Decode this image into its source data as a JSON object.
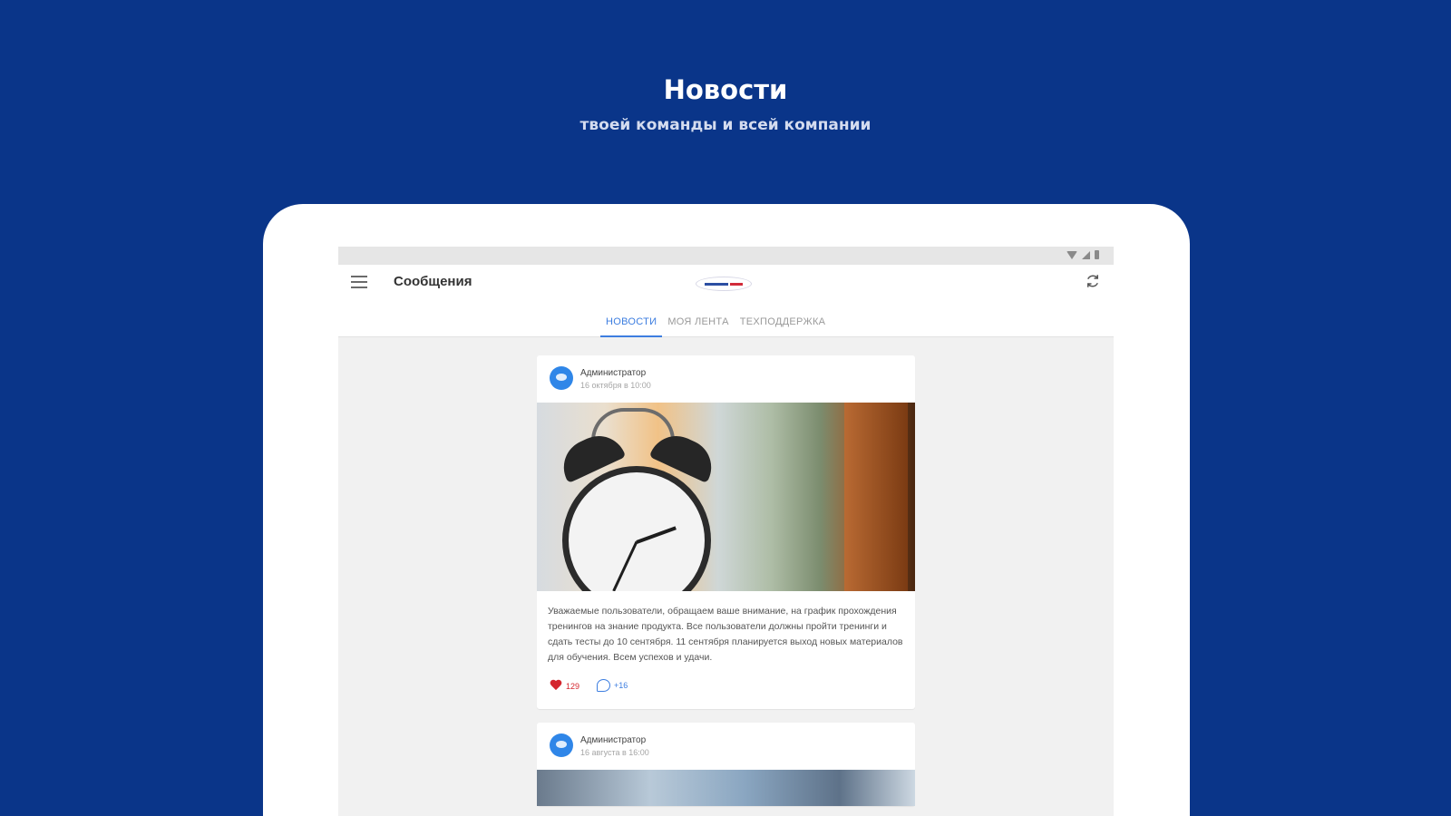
{
  "hero": {
    "title": "Новости",
    "subtitle": "твоей команды и всей компании"
  },
  "app": {
    "title": "Сообщения",
    "tabs": [
      {
        "label": "НОВОСТИ",
        "active": true
      },
      {
        "label": "МОЯ ЛЕНТА",
        "active": false
      },
      {
        "label": "ТЕХПОДДЕРЖКА",
        "active": false
      }
    ]
  },
  "posts": [
    {
      "author": "Администратор",
      "date": "16 октября в 10:00",
      "text": "Уважаемые пользователи, обращаем ваше внимание, на график прохождения тренингов на знание продукта. Все пользователи должны пройти тренинги и сдать тесты до 10 сентября. 11 сентября планируется выход новых материалов для обучения. Всем успехов и удачи.",
      "likes": "129",
      "comments": "+16"
    },
    {
      "author": "Администратор",
      "date": "16 августа в 16:00"
    }
  ],
  "colors": {
    "background": "#0a3589",
    "accent": "#3d7ee0",
    "like": "#d4272f"
  },
  "icons": [
    "menu-icon",
    "refresh-icon",
    "heart-icon",
    "comment-icon",
    "wifi-icon",
    "signal-icon",
    "battery-icon"
  ]
}
